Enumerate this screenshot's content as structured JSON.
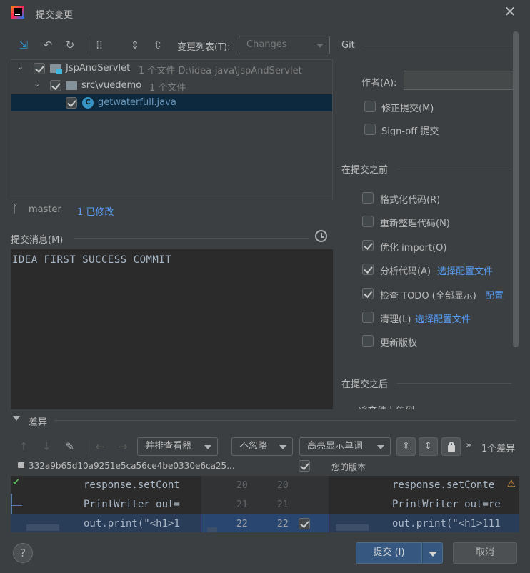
{
  "window": {
    "title": "提交变更"
  },
  "toolbar": {
    "changelist_label": "变更列表(T):",
    "changelist_value": "Changes"
  },
  "tree": {
    "root_name": "JspAndServlet",
    "root_meta": "1 个文件  D:\\idea-java\\JspAndServlet",
    "folder_name": "src\\vuedemo",
    "folder_meta": "1 个文件",
    "file_name": "getwaterfull.java"
  },
  "branch": {
    "name": "master",
    "modified": "1 已修改"
  },
  "commit_message": {
    "label": "提交消息(M)",
    "text": "IDEA FIRST SUCCESS COMMIT"
  },
  "git": {
    "title": "Git",
    "author_label": "作者(A):",
    "author_value": "",
    "amend": "修正提交(M)",
    "signoff": "Sign-off 提交"
  },
  "before_commit": {
    "title": "在提交之前",
    "items": [
      {
        "label": "格式化代码(R)",
        "checked": false,
        "link": ""
      },
      {
        "label": "重新整理代码(N)",
        "checked": false,
        "link": ""
      },
      {
        "label": "优化 import(O)",
        "checked": true,
        "link": ""
      },
      {
        "label": "分析代码(A)",
        "checked": true,
        "link": "选择配置文件"
      },
      {
        "label": "检查 TODO (全部显示)",
        "checked": true,
        "link": "配置"
      },
      {
        "label": "清理(L)",
        "checked": false,
        "link": "选择配置文件"
      },
      {
        "label": "更新版权",
        "checked": false,
        "link": ""
      }
    ]
  },
  "after_commit": {
    "title": "在提交之后",
    "partial": "将文件上传到"
  },
  "diff": {
    "title": "差异",
    "viewer": "并排查看器",
    "ignore": "不忽略",
    "highlight": "高亮显示单词",
    "count": "1个差异",
    "hash": "332a9b65d10a9251e5ca56ce4be0330e6ca25...",
    "your_version": "您的版本",
    "left_lines": [
      "response.setCont",
      "PrintWriter out=",
      "out.print(\"<h1>1"
    ],
    "right_lines": [
      "response.setConte",
      "PrintWriter out=re",
      "out.print(\"<h1>111"
    ],
    "line_numbers_left": [
      "20",
      "21",
      "22"
    ],
    "line_numbers_right": [
      "20",
      "21",
      "22"
    ]
  },
  "buttons": {
    "help": "?",
    "commit": "提交 (I)",
    "cancel": "取消"
  },
  "colors": {
    "accent": "#365880",
    "selection": "#0d293e",
    "link": "#589df6",
    "primary_button": "#365880"
  }
}
